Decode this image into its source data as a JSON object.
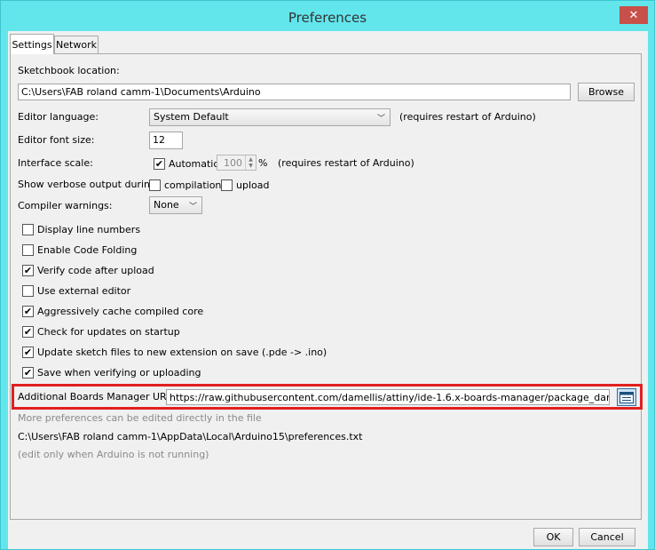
{
  "window": {
    "title": "Preferences",
    "close_glyph": "✕"
  },
  "tabs": [
    {
      "label": "Settings"
    },
    {
      "label": "Network"
    }
  ],
  "sketchbook": {
    "label": "Sketchbook location:",
    "value": "C:\\Users\\FAB roland camm-1\\Documents\\Arduino",
    "browse": "Browse"
  },
  "editor_language": {
    "label": "Editor language:",
    "value": "System Default",
    "note": "(requires restart of Arduino)"
  },
  "editor_font_size": {
    "label": "Editor font size:",
    "value": "12"
  },
  "interface_scale": {
    "label": "Interface scale:",
    "automatic_label": "Automatic",
    "automatic_checked": true,
    "value": "100",
    "unit": "%",
    "note": "(requires restart of Arduino)"
  },
  "verbose": {
    "label": "Show verbose output during:",
    "compilation": "compilation",
    "upload": "upload",
    "compilation_checked": false,
    "upload_checked": false
  },
  "compiler_warnings": {
    "label": "Compiler warnings:",
    "value": "None"
  },
  "options": [
    {
      "label": "Display line numbers",
      "checked": false
    },
    {
      "label": "Enable Code Folding",
      "checked": false
    },
    {
      "label": "Verify code after upload",
      "checked": true
    },
    {
      "label": "Use external editor",
      "checked": false
    },
    {
      "label": "Aggressively cache compiled core",
      "checked": true
    },
    {
      "label": "Check for updates on startup",
      "checked": true
    },
    {
      "label": "Update sketch files to new extension on save (.pde -> .ino)",
      "checked": true
    },
    {
      "label": "Save when verifying or uploading",
      "checked": true
    }
  ],
  "boards_manager": {
    "label": "Additional Boards Manager URLs:",
    "value": "https://raw.githubusercontent.com/damellis/attiny/ide-1.6.x-boards-manager/package_damellis_attiny_index.json",
    "icon": "window-list-icon"
  },
  "more_prefs": {
    "text": "More preferences can be edited directly in the file",
    "path": "C:\\Users\\FAB roland camm-1\\AppData\\Local\\Arduino15\\preferences.txt",
    "note": "(edit only when Arduino is not running)"
  },
  "buttons": {
    "ok": "OK",
    "cancel": "Cancel"
  },
  "colors": {
    "titlebar": "#63e5ec",
    "close": "#c7504a",
    "highlight": "#e0201f"
  }
}
